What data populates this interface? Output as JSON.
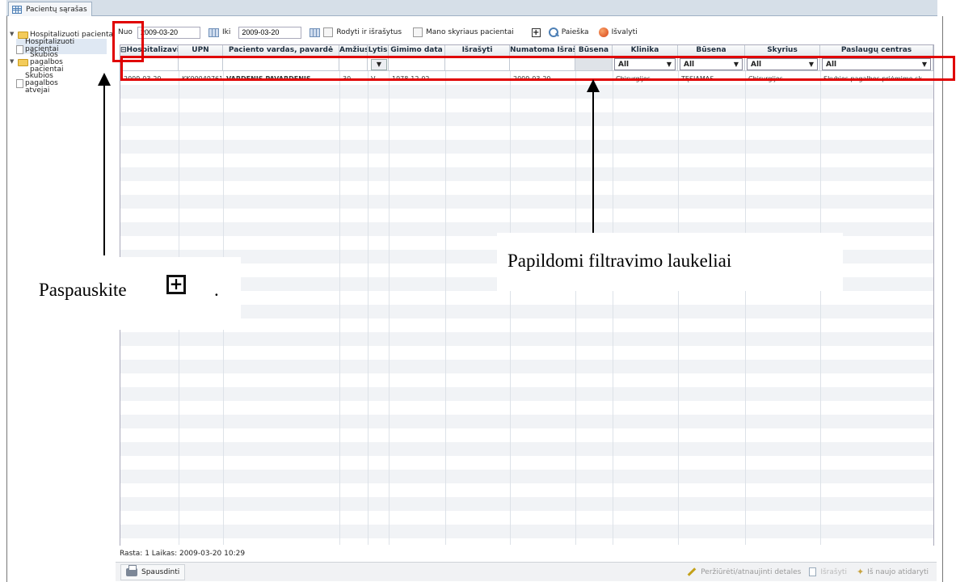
{
  "tab": {
    "label": "Pacientų sąrašas"
  },
  "tree": {
    "items": [
      {
        "label": "Hospitalizuoti pacienta",
        "kind": "folder"
      },
      {
        "label": "Hospitalizuoti pacientai",
        "kind": "doc"
      },
      {
        "label": "Skubios pagalbos pacientai",
        "kind": "folder"
      },
      {
        "label": "Skubios pagalbos atvejai",
        "kind": "doc"
      }
    ]
  },
  "filter": {
    "from_label": "Nuo",
    "from_value": "2009-03-20",
    "to_label": "Iki",
    "to_value": "2009-03-20",
    "show_discharged": "Rodyti ir išrašytus",
    "my_department": "Mano skyriaus pacientai",
    "search": "Paieška",
    "clear": "Išvalyti"
  },
  "table": {
    "headers": [
      "Hospitalizavimo",
      "UPN",
      "Paciento vardas, pavardė",
      "Amžius",
      "Lytis",
      "Gimimo data",
      "Išrašyti",
      "Numatoma Išraš",
      "Būsena",
      "Klinika",
      "Būsena",
      "Skyrius",
      "Paslaugų centras"
    ],
    "filter_all": "All",
    "row": [
      "2009-03-20",
      "KK00049761",
      "VARDENIS PAVARDENIS",
      "30",
      "V",
      "1978-12-02",
      "",
      "2009-03-20",
      "",
      "Chirurgijos",
      "TĘSIAMAS",
      "Chirurgijos",
      "Skubios pagalbos priėmimo sk."
    ]
  },
  "status": "Rasta: 1  Laikas: 2009-03-20 10:29",
  "buttons": {
    "print": "Spausdinti",
    "details": "Peržiūrėti/atnaujinti detales",
    "discharge": "Išrašyti",
    "reopen": "Iš naujo atidaryti"
  },
  "annotations": {
    "extra_filters": "Papildomi filtravimo laukeliai",
    "press": "Paspauskite",
    "press_end": "."
  },
  "colors": {
    "highlight": "#e00000",
    "accent": "#4d7fb5"
  }
}
